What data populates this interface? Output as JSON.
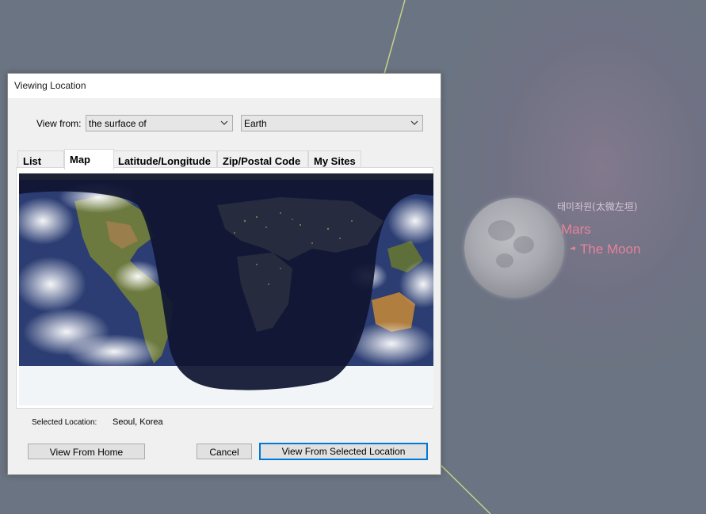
{
  "sky": {
    "labels": {
      "korean": "태미좌원(太微左垣)",
      "mars": "Mars",
      "moon": "The Moon"
    },
    "colors": {
      "planet_label": "#e7839a",
      "constellation_line": "#c6d08a",
      "background": "#6b7482"
    }
  },
  "dialog": {
    "title": "Viewing Location",
    "view_from": {
      "label": "View from:",
      "mode_selected": "the surface of",
      "body_selected": "Earth"
    },
    "tabs": [
      {
        "label": "List",
        "active": false
      },
      {
        "label": "Map",
        "active": true
      },
      {
        "label": "Latitude/Longitude",
        "active": false
      },
      {
        "label": "Zip/Postal Code",
        "active": false
      },
      {
        "label": "My Sites",
        "active": false
      }
    ],
    "selected_location": {
      "label": "Selected Location:",
      "value": "Seoul, Korea"
    },
    "buttons": {
      "view_from_home": "View From Home",
      "cancel": "Cancel",
      "view_from_selected": "View From Selected Location"
    },
    "colors": {
      "default_button_border": "#0078d7"
    }
  }
}
